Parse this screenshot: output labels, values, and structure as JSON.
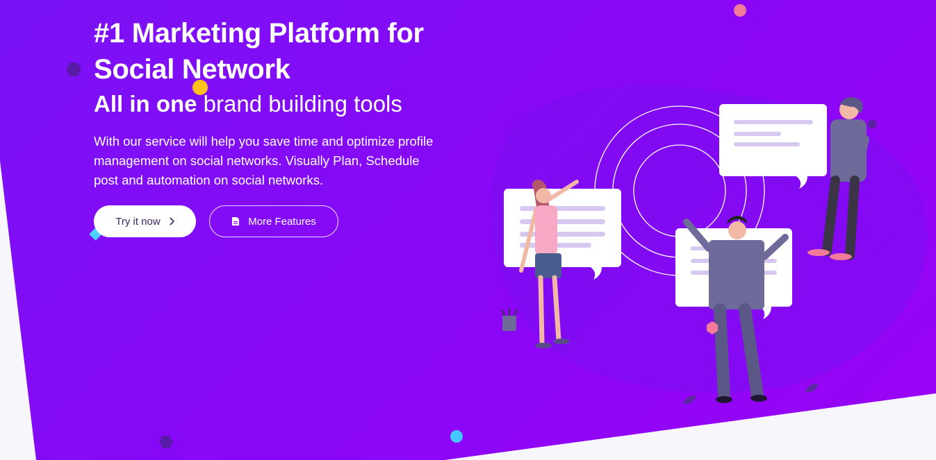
{
  "hero": {
    "title": "#1 Marketing Platform for Social Network",
    "subtitle_bold": "All in one",
    "subtitle_rest": " brand building tools",
    "description": "With our service will help you save time and optimize profile management on social networks. Visually Plan, Schedule post and automation on social networks."
  },
  "buttons": {
    "primary_label": "Try it now",
    "secondary_label": "More Features"
  },
  "colors": {
    "gradient_start": "#7a12f5",
    "gradient_end": "#9a04f6",
    "page_background": "#f7f7fb",
    "button_text": "#3a2560"
  },
  "icons": {
    "primary_button": "chevron-right-icon",
    "secondary_button": "document-icon"
  }
}
